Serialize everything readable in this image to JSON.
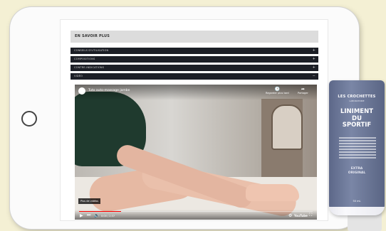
{
  "section": {
    "header": "EN SAVOIR PLUS"
  },
  "accordion": {
    "items": [
      {
        "label": "CONSEILS D'UTILISATION",
        "icon": "plus-icon",
        "symbol": "+"
      },
      {
        "label": "COMPOSITIONS",
        "icon": "plus-icon",
        "symbol": "+"
      },
      {
        "label": "CONTRE-INDICATIONS",
        "icon": "plus-icon",
        "symbol": "+"
      },
      {
        "label": "VIDÉO",
        "icon": "minus-icon",
        "symbol": "−"
      }
    ]
  },
  "video": {
    "title": "Tuto auto-massage jambe",
    "watch_later": "Regarder plus tard",
    "share": "Partager",
    "caption_badge": "Plus de vidéos",
    "timecode": "0:00 / 2:37",
    "provider": "YouTube",
    "progress": 0.18,
    "icons": {
      "play": "▶",
      "next": "⏭",
      "volume": "🔊",
      "settings": "⚙",
      "fullscreen": "⛶",
      "clock": "🕒",
      "share": "➦"
    }
  },
  "product": {
    "brand": "LES CROCHETTES",
    "brand_sub": "LABORATOIRE",
    "name_line1": "LINIMENT",
    "name_line2": "DU",
    "name_line3": "SPORTIF",
    "extra_line1": "EXTRA",
    "extra_line2": "ORIGINAL",
    "volume": "50 mL"
  },
  "colors": {
    "page_bg": "#f4f0d4",
    "accordion_bg": "#1c1f26",
    "progress": "#ff0000",
    "tube_band": "#6b7696"
  }
}
